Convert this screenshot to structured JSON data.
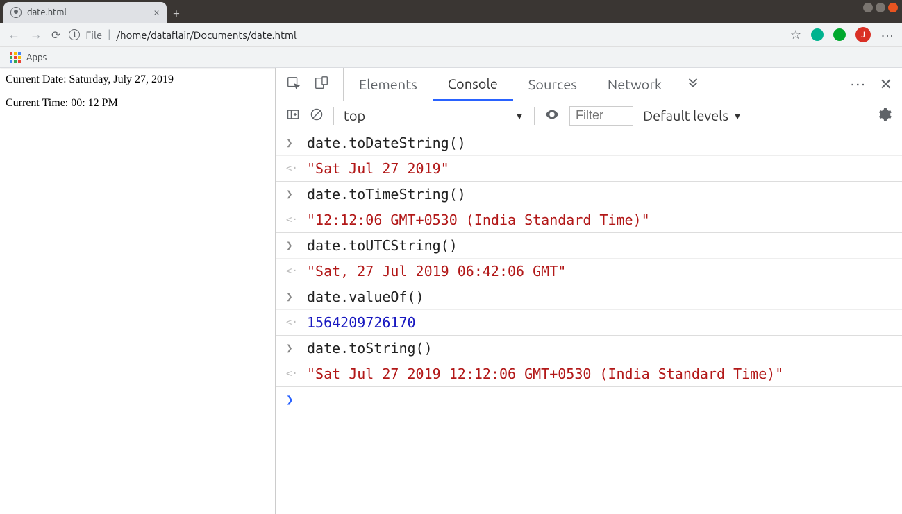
{
  "window": {
    "tab_title": "date.html",
    "url_scheme": "File",
    "url_path": "/home/dataflair/Documents/date.html"
  },
  "bookmarks": {
    "apps_label": "Apps"
  },
  "page": {
    "line1": "Current Date: Saturday, July 27, 2019",
    "line2": "Current Time: 00: 12 PM"
  },
  "devtools": {
    "tabs": {
      "elements": "Elements",
      "console": "Console",
      "sources": "Sources",
      "network": "Network"
    },
    "toolbar": {
      "context": "top",
      "filter_placeholder": "Filter",
      "levels": "Default levels"
    },
    "console": [
      {
        "type": "in",
        "text": "date.toDateString()"
      },
      {
        "type": "out",
        "kind": "str",
        "text": "\"Sat Jul 27 2019\""
      },
      {
        "type": "in",
        "text": "date.toTimeString()"
      },
      {
        "type": "out",
        "kind": "str",
        "text": "\"12:12:06 GMT+0530 (India Standard Time)\""
      },
      {
        "type": "in",
        "text": "date.toUTCString()"
      },
      {
        "type": "out",
        "kind": "str",
        "text": "\"Sat, 27 Jul 2019 06:42:06 GMT\""
      },
      {
        "type": "in",
        "text": "date.valueOf()"
      },
      {
        "type": "out",
        "kind": "num",
        "text": "1564209726170"
      },
      {
        "type": "in",
        "text": "date.toString()"
      },
      {
        "type": "out",
        "kind": "str",
        "text": "\"Sat Jul 27 2019 12:12:06 GMT+0530 (India Standard Time)\""
      }
    ]
  },
  "avatar_letter": "J"
}
